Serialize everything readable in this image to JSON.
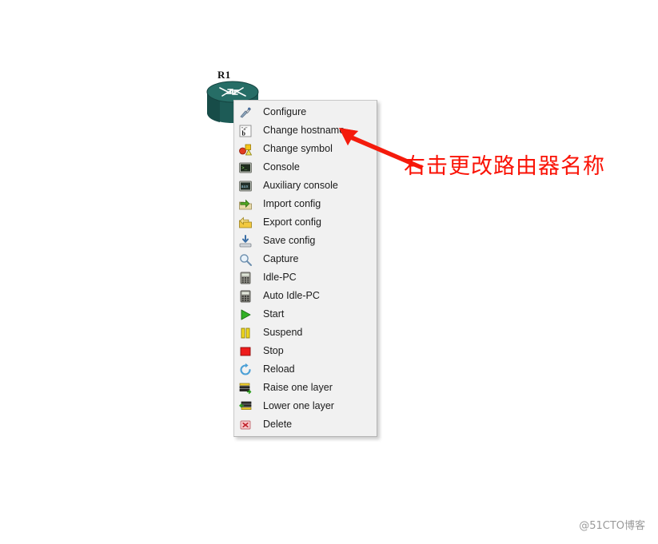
{
  "canvas": {
    "background_color": "#ffffff"
  },
  "node": {
    "label": "R1",
    "icon_name": "router-icon",
    "body_color": "#1d5b56",
    "top_color": "#2a6f69",
    "arrow_color": "#ffffff"
  },
  "context_menu": {
    "background_color": "#f1f1f1",
    "border_color": "#c8c8c8",
    "text_color": "#1b1b1b",
    "items": [
      {
        "label": "Configure",
        "icon": "wrench-screwdriver-icon"
      },
      {
        "label": "Change hostname",
        "icon": "rename-text-icon"
      },
      {
        "label": "Change symbol",
        "icon": "shapes-palette-icon"
      },
      {
        "label": "Console",
        "icon": "terminal-icon"
      },
      {
        "label": "Auxiliary console",
        "icon": "terminal-aux-icon"
      },
      {
        "label": "Import config",
        "icon": "import-arrow-icon"
      },
      {
        "label": "Export config",
        "icon": "export-arrow-icon"
      },
      {
        "label": "Save config",
        "icon": "save-disk-icon"
      },
      {
        "label": "Capture",
        "icon": "magnifier-icon"
      },
      {
        "label": "Idle-PC",
        "icon": "calculator-icon"
      },
      {
        "label": "Auto Idle-PC",
        "icon": "calculator-auto-icon"
      },
      {
        "label": "Start",
        "icon": "play-icon"
      },
      {
        "label": "Suspend",
        "icon": "pause-icon"
      },
      {
        "label": "Stop",
        "icon": "stop-icon"
      },
      {
        "label": "Reload",
        "icon": "reload-icon"
      },
      {
        "label": "Raise one layer",
        "icon": "raise-layer-icon"
      },
      {
        "label": "Lower one layer",
        "icon": "lower-layer-icon"
      },
      {
        "label": "Delete",
        "icon": "delete-icon"
      }
    ]
  },
  "annotation": {
    "text": "右击更改路由器名称",
    "color": "#fa1205",
    "arrow_name": "red-pointer-arrow"
  },
  "watermark": {
    "text": "@51CTO博客",
    "color": "#9a9a9a"
  }
}
